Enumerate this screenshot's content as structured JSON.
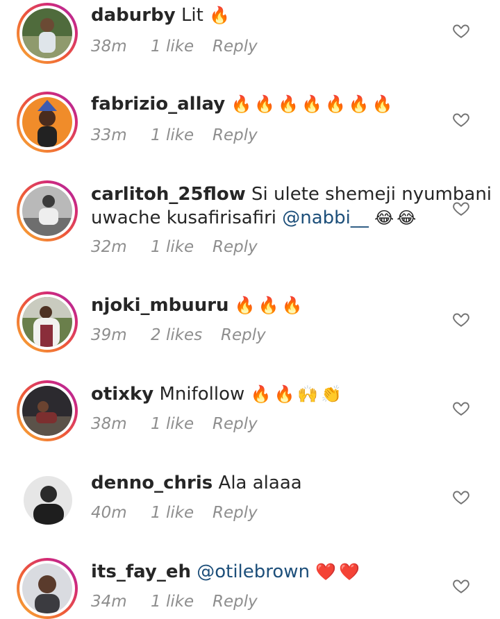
{
  "comments": [
    {
      "username": "daburby",
      "text": "Lit",
      "emoji": "🔥",
      "time": "38m",
      "likes": "1 like",
      "reply": "Reply"
    },
    {
      "username": "fabrizio_allay",
      "text": "",
      "emoji": "🔥🔥🔥🔥🔥🔥🔥",
      "time": "33m",
      "likes": "1 like",
      "reply": "Reply"
    },
    {
      "username": "carlitoh_25flow",
      "text": "Si ulete shemeji nyumbani",
      "text2": "uwache kusafirisafiri",
      "mention": "@nabbi__",
      "emoji": "😂😂",
      "time": "32m",
      "likes": "1 like",
      "reply": "Reply"
    },
    {
      "username": "njoki_mbuuru",
      "text": "",
      "emoji": "🔥🔥🔥",
      "time": "39m",
      "likes": "2 likes",
      "reply": "Reply"
    },
    {
      "username": "otixky",
      "text": "Mnifollow",
      "emoji": "🔥🔥🙌👏",
      "time": "38m",
      "likes": "1 like",
      "reply": "Reply"
    },
    {
      "username": "denno_chris",
      "text": "Ala alaaa",
      "emoji": "",
      "time": "40m",
      "likes": "1 like",
      "reply": "Reply"
    },
    {
      "username": "its_fay_eh",
      "text": "",
      "mention": "@otilebrown",
      "emoji": "❤️❤️",
      "time": "34m",
      "likes": "1 like",
      "reply": "Reply"
    }
  ],
  "icons": {
    "like": "heart-outline-icon"
  },
  "colors": {
    "meta": "#8e8e8e",
    "mention": "#1d4f7a",
    "ring_start": "#f9b233",
    "ring_end": "#a12bb0"
  }
}
